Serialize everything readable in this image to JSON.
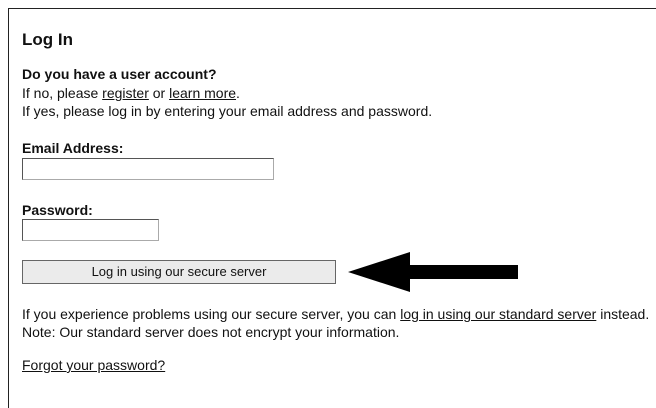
{
  "login": {
    "title": "Log In",
    "question": "Do you have a user account?",
    "no_prefix": "If no, please ",
    "register_link": "register",
    "or_text": " or ",
    "learn_more_link": "learn more",
    "period": ".",
    "yes_line": "If yes, please log in by entering your email address and password.",
    "email_label": "Email Address:",
    "email_value": "",
    "password_label": "Password:",
    "password_value": "",
    "submit_label": "Log in using our secure server",
    "help_prefix": "If you experience problems using our secure server, you can ",
    "standard_link": "log in using our standard server",
    "help_suffix": " instead. Note: Our standard server does not encrypt your information.",
    "forgot_link": "Forgot your password?"
  },
  "annotation": {
    "arrow_icon": "arrow-left-icon",
    "arrow_color": "#000000"
  }
}
